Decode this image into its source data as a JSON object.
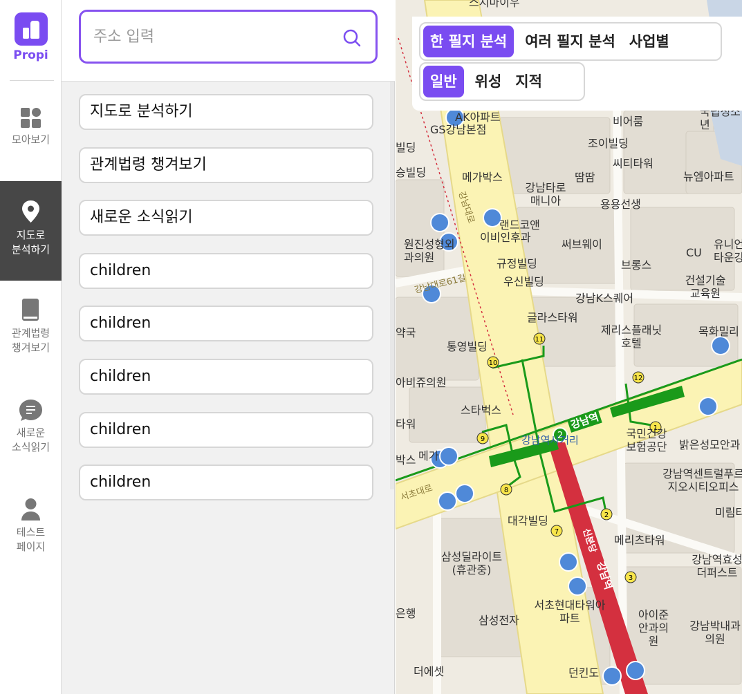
{
  "brand": {
    "name": "Propi",
    "color": "#7a4cf1"
  },
  "nav": [
    {
      "id": "overview",
      "label": "모아보기",
      "icon": "grid-icon",
      "active": false
    },
    {
      "id": "map-analysis",
      "label": "지도로\n분석하기",
      "icon": "map-pin-icon",
      "active": true
    },
    {
      "id": "laws",
      "label": "관계법령\n챙겨보기",
      "icon": "book-icon",
      "active": false
    },
    {
      "id": "news",
      "label": "새로운\n소식읽기",
      "icon": "chat-icon",
      "active": false
    },
    {
      "id": "test",
      "label": "테스트\n페이지",
      "icon": "user-icon",
      "active": false
    }
  ],
  "search": {
    "placeholder": "주소 입력",
    "icon": "search-icon"
  },
  "menu_items": [
    "지도로 분석하기",
    "관계법령 챙겨보기",
    "새로운 소식읽기",
    "children",
    "children",
    "children",
    "children",
    "children"
  ],
  "map_controls": {
    "analysis_tabs": [
      {
        "label": "한 필지 분석",
        "active": true
      },
      {
        "label": "여러 필지 분석",
        "active": false
      },
      {
        "label": "사업별",
        "active": false
      }
    ],
    "layer_tabs": [
      {
        "label": "일반",
        "active": true
      },
      {
        "label": "위성",
        "active": false
      },
      {
        "label": "지적",
        "active": false
      }
    ]
  },
  "map_labels": [
    "스시마이우",
    "AK아파트",
    "GS강남본점",
    "비어룸",
    "국립청소년",
    "조이빌딩",
    "씨티타워",
    "메가박스",
    "강남타로매니아",
    "땀땀",
    "뉴엠아파트",
    "용용선생",
    "랜드코앤",
    "원진성형외과의원",
    "이비인후과",
    "써브웨이",
    "유니언타운강",
    "CU",
    "규정빌딩",
    "브롱스",
    "우신빌딩",
    "건설기술교육원",
    "강남K스퀘어",
    "글라스타워",
    "제리스플래닛호텔",
    "목화밀리",
    "통영빌딩",
    "아비쥬의원",
    "스타벅스",
    "강남역",
    "강남역사거리",
    "국민건강보험공단",
    "밝은성모안과",
    "강남역센트럴푸르지오시티오피스",
    "미림타",
    "대각빌딩",
    "메리츠타워",
    "삼성딜라이트(휴관중)",
    "강남역효성더퍼스트",
    "서초현대타워아파트",
    "아이준안과의원",
    "강남박내과의원",
    "삼성전자",
    "더에셋",
    "던킨도",
    "약국",
    "은행",
    "승빌딩",
    "빌딩",
    "타워",
    "박스",
    "메가"
  ],
  "road_labels": [
    "강남대로",
    "강남대로61길",
    "서초대로",
    "신분당",
    "강남역"
  ],
  "colors": {
    "accent": "#7a4cf1",
    "active_nav": "#474747",
    "line2_green": "#1a9a1a",
    "sinbundang_red": "#d4303f",
    "road_yellow": "#fbf3b4"
  }
}
